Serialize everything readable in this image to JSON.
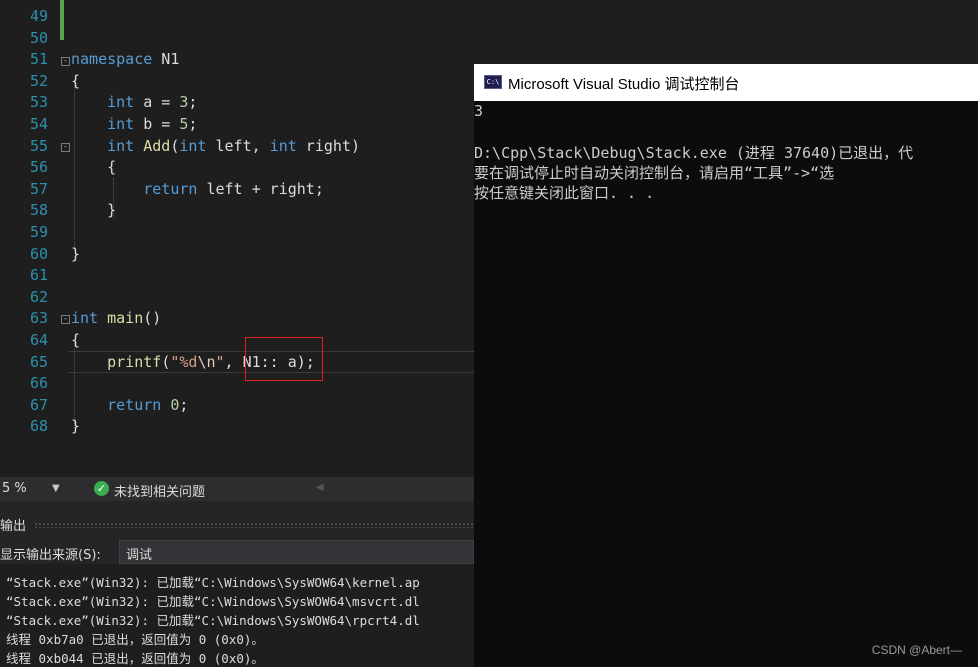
{
  "editor": {
    "lines": [
      {
        "n": "49"
      },
      {
        "n": "50"
      },
      {
        "n": "51",
        "parts": [
          [
            "namespace",
            "kw"
          ],
          [
            " N1",
            "id"
          ]
        ]
      },
      {
        "n": "52",
        "parts": [
          [
            "{",
            "id"
          ]
        ]
      },
      {
        "n": "53",
        "parts": [
          [
            "    ",
            "id"
          ],
          [
            "int",
            "kw"
          ],
          [
            " a = ",
            "id"
          ],
          [
            "3",
            "num"
          ],
          [
            ";",
            "id"
          ]
        ]
      },
      {
        "n": "54",
        "parts": [
          [
            "    ",
            "id"
          ],
          [
            "int",
            "kw"
          ],
          [
            " b = ",
            "id"
          ],
          [
            "5",
            "num"
          ],
          [
            ";",
            "id"
          ]
        ]
      },
      {
        "n": "55",
        "parts": [
          [
            "    ",
            "id"
          ],
          [
            "int",
            "kw"
          ],
          [
            " ",
            "id"
          ],
          [
            "Add",
            "fn"
          ],
          [
            "(",
            "id"
          ],
          [
            "int",
            "kw"
          ],
          [
            " left, ",
            "id"
          ],
          [
            "int",
            "kw"
          ],
          [
            " right)",
            "id"
          ]
        ]
      },
      {
        "n": "56",
        "parts": [
          [
            "    {",
            "id"
          ]
        ]
      },
      {
        "n": "57",
        "parts": [
          [
            "        ",
            "id"
          ],
          [
            "return",
            "kw"
          ],
          [
            " left + right;",
            "id"
          ]
        ]
      },
      {
        "n": "58",
        "parts": [
          [
            "    }",
            "id"
          ]
        ]
      },
      {
        "n": "59"
      },
      {
        "n": "60",
        "parts": [
          [
            "}",
            "id"
          ]
        ]
      },
      {
        "n": "61"
      },
      {
        "n": "62"
      },
      {
        "n": "63",
        "parts": [
          [
            "int",
            "kw"
          ],
          [
            " ",
            "id"
          ],
          [
            "main",
            "fn"
          ],
          [
            "()",
            "id"
          ]
        ]
      },
      {
        "n": "64",
        "parts": [
          [
            "{",
            "id"
          ]
        ]
      },
      {
        "n": "65",
        "parts": [
          [
            "    ",
            "id"
          ],
          [
            "printf",
            "fn"
          ],
          [
            "(",
            "id"
          ],
          [
            "\"%d",
            "str"
          ],
          [
            "\\n",
            "esc"
          ],
          [
            "\"",
            "str"
          ],
          [
            ", N1:: a);",
            "id"
          ]
        ]
      },
      {
        "n": "66"
      },
      {
        "n": "67",
        "parts": [
          [
            "    ",
            "id"
          ],
          [
            "return",
            "kw"
          ],
          [
            " ",
            "id"
          ],
          [
            "0",
            "num"
          ],
          [
            ";",
            "id"
          ]
        ]
      },
      {
        "n": "68",
        "parts": [
          [
            "}",
            "id"
          ]
        ]
      }
    ]
  },
  "statusbar": {
    "zoom": "5 %",
    "issues_text": "未找到相关问题"
  },
  "output": {
    "title": "输出",
    "source_label": "显示输出来源(S):",
    "source_value": "调试",
    "log": [
      "“Stack.exe”(Win32): 已加载“C:\\Windows\\SysWOW64\\kernel.ap",
      "“Stack.exe”(Win32): 已加载“C:\\Windows\\SysWOW64\\msvcrt.dl",
      "“Stack.exe”(Win32): 已加载“C:\\Windows\\SysWOW64\\rpcrt4.dl",
      "线程 0xb7a0 已退出，返回值为 0 (0x0)。",
      "线程 0xb044 已退出，返回值为 0 (0x0)。"
    ]
  },
  "console": {
    "title": "Microsoft Visual Studio 调试控制台",
    "icon_text": "C:\\",
    "lines": [
      "3",
      "",
      "D:\\Cpp\\Stack\\Debug\\Stack.exe (进程 37640)已退出，代",
      "要在调试停止时自动关闭控制台，请启用“工具”->“选",
      "按任意键关闭此窗口. . ."
    ]
  },
  "watermark": "CSDN @Abert—"
}
